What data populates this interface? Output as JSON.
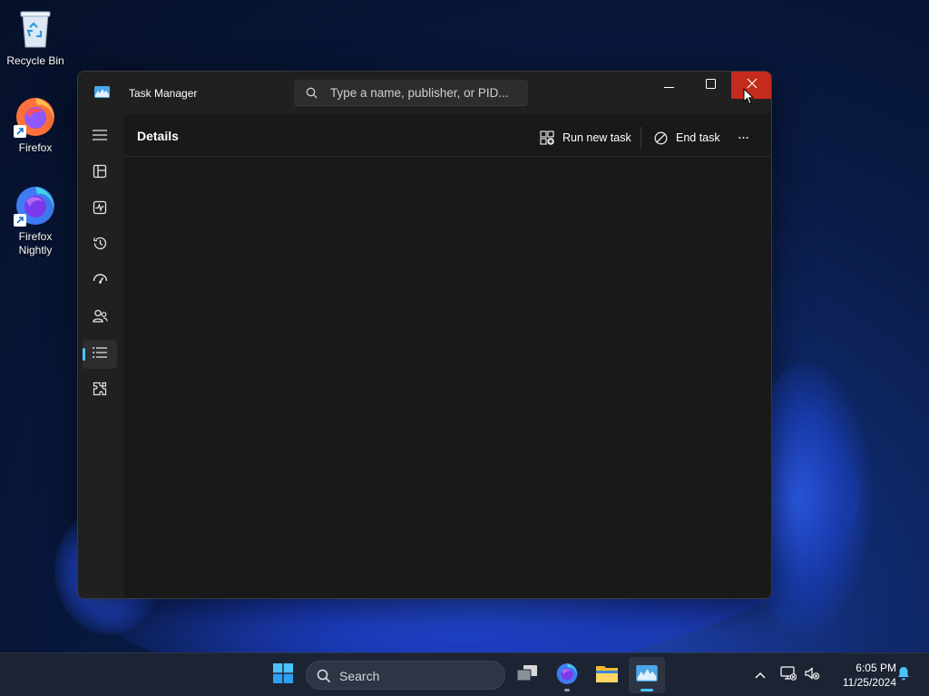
{
  "desktop": {
    "icons": [
      {
        "label": "Recycle Bin"
      },
      {
        "label": "Firefox"
      },
      {
        "label": "Firefox Nightly"
      }
    ]
  },
  "window": {
    "title": "Task Manager",
    "search_placeholder": "Type a name, publisher, or PID...",
    "close_color": "#c42b1c"
  },
  "nav": {
    "items": [
      {
        "icon": "hamburger-menu-icon"
      },
      {
        "icon": "processes-icon"
      },
      {
        "icon": "performance-icon"
      },
      {
        "icon": "app-history-icon"
      },
      {
        "icon": "startup-apps-icon"
      },
      {
        "icon": "users-icon"
      },
      {
        "icon": "details-icon",
        "active": true
      },
      {
        "icon": "services-icon"
      },
      {
        "icon": "settings-icon"
      }
    ],
    "accent": "#4cc2ff"
  },
  "content": {
    "page_title": "Details",
    "run_new_task": "Run new task",
    "end_task": "End task"
  },
  "taskbar": {
    "search_label": "Search",
    "time": "6:05 PM",
    "date": "11/25/2024"
  }
}
